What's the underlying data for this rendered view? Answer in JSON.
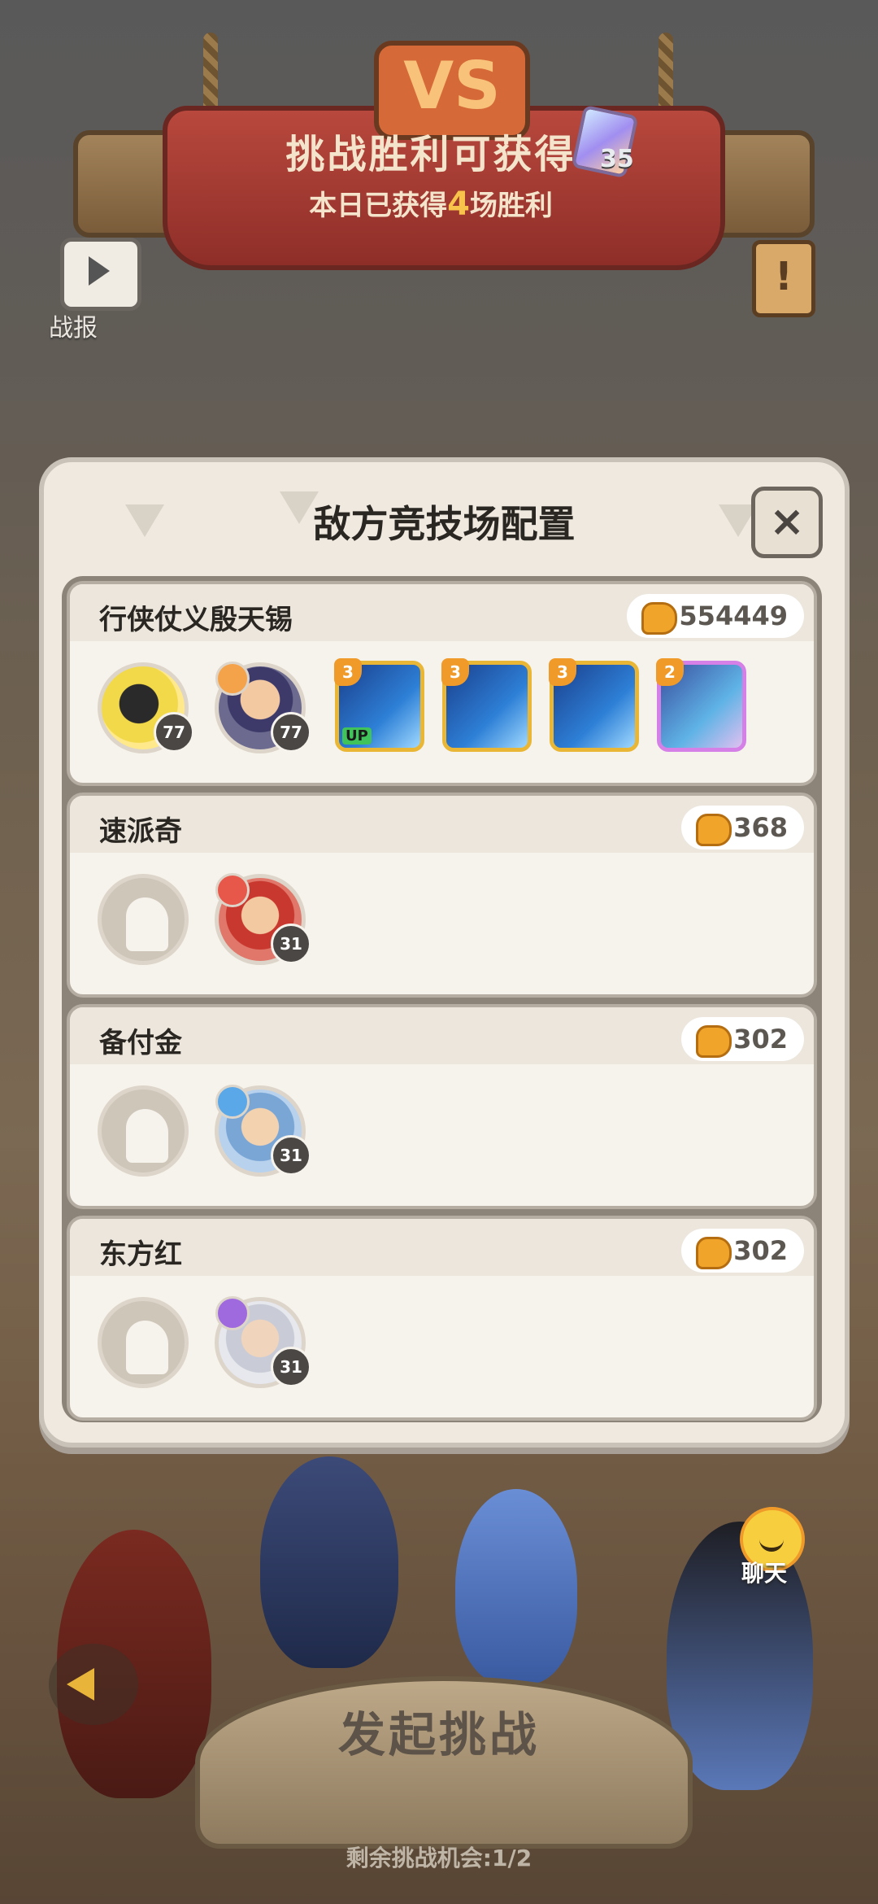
{
  "banner": {
    "title": "挑战胜利可获得",
    "sub_prefix": "本日已获得",
    "sub_wins": "4",
    "sub_suffix": "场胜利",
    "reward_count": "35",
    "vs_label": "VS"
  },
  "replay_label": "战报",
  "panel": {
    "title": "敌方竞技场配置",
    "close_label": "×"
  },
  "opponents": [
    {
      "name": "行侠仗义殷天锡",
      "power": "554449",
      "pets": [
        {
          "level": "77",
          "empty": false
        },
        {
          "level": "77",
          "empty": false
        }
      ],
      "skills": [
        {
          "tier": "3",
          "up": "UP",
          "style": "blue"
        },
        {
          "tier": "3",
          "up": "",
          "style": "blue"
        },
        {
          "tier": "3",
          "up": "",
          "style": "blue"
        },
        {
          "tier": "2",
          "up": "",
          "style": "purple"
        }
      ]
    },
    {
      "name": "速派奇",
      "power": "368",
      "pets": [
        {
          "empty": true
        },
        {
          "level": "31",
          "empty": false
        }
      ],
      "skills": []
    },
    {
      "name": "备付金",
      "power": "302",
      "pets": [
        {
          "empty": true
        },
        {
          "level": "31",
          "empty": false
        }
      ],
      "skills": []
    },
    {
      "name": "东方红",
      "power": "302",
      "pets": [
        {
          "empty": true
        },
        {
          "level": "31",
          "empty": false
        }
      ],
      "skills": []
    }
  ],
  "challenge_button": "发起挑战",
  "remaining": "剩余挑战机会:1/2",
  "chat_label": "聊天"
}
